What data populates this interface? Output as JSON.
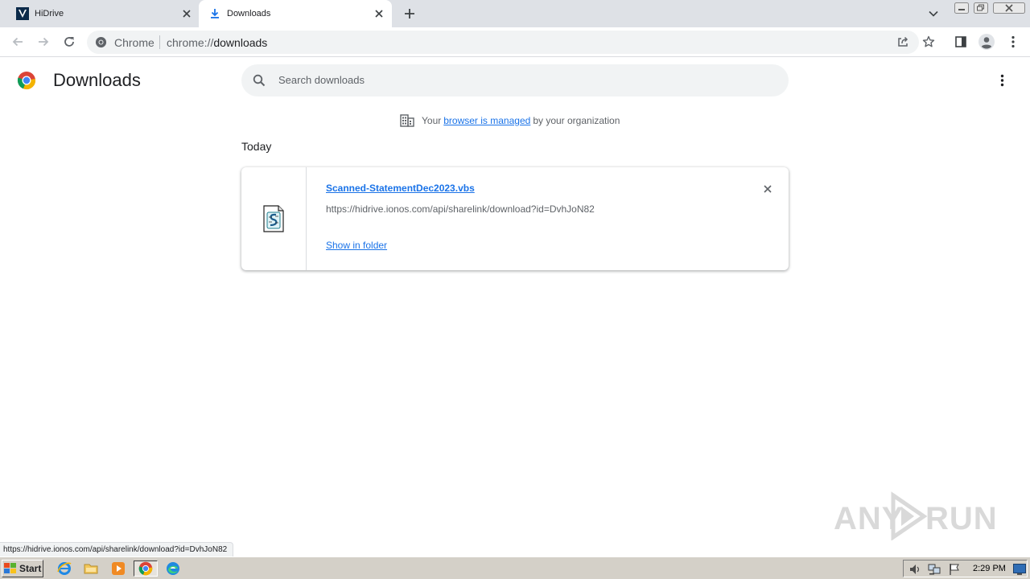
{
  "browser": {
    "tabs": [
      {
        "title": "HiDrive",
        "active": false,
        "icon": "hidrive-logo-icon"
      },
      {
        "title": "Downloads",
        "active": true,
        "icon": "download-arrow-icon"
      }
    ],
    "omnibox": {
      "site_label": "Chrome",
      "url_scheme": "chrome://",
      "url_host": "downloads"
    }
  },
  "page": {
    "title": "Downloads",
    "search_placeholder": "Search downloads",
    "managed_notice": {
      "prefix": "Your",
      "link_text": "browser is managed",
      "suffix": "by your organization"
    },
    "section_label": "Today",
    "download": {
      "file_name": "Scanned-StatementDec2023.vbs",
      "source_url": "https://hidrive.ionos.com/api/sharelink/download?id=DvhJoN82",
      "action_label": "Show in folder",
      "file_icon": "vbs-script-file-icon"
    }
  },
  "status_bubble": "https://hidrive.ionos.com/api/sharelink/download?id=DvhJoN82",
  "watermark": "ANY RUN",
  "taskbar": {
    "start_label": "Start",
    "clock": "2:29 PM",
    "pinned": [
      "ie-icon",
      "explorer-folder-icon",
      "media-player-icon",
      "chrome-icon",
      "edge-icon"
    ]
  },
  "colors": {
    "accent": "#1a73e8",
    "tabstrip": "#dee1e6",
    "taskbar": "#d4d0c8"
  }
}
